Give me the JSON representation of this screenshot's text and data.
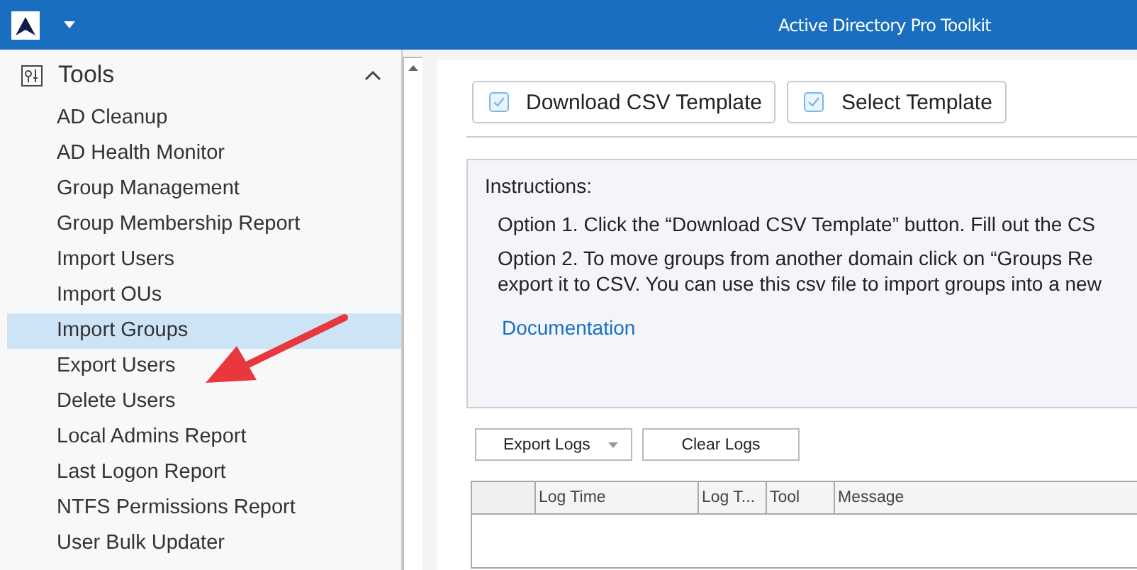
{
  "window": {
    "title": "Active Directory Pro Toolkit"
  },
  "sidebar": {
    "title": "Tools",
    "expanded": true,
    "items": [
      {
        "label": "AD Cleanup",
        "selected": false
      },
      {
        "label": "AD Health Monitor",
        "selected": false
      },
      {
        "label": "Group Management",
        "selected": false
      },
      {
        "label": "Group Membership Report",
        "selected": false
      },
      {
        "label": "Import Users",
        "selected": false
      },
      {
        "label": "Import OUs",
        "selected": false
      },
      {
        "label": "Import Groups",
        "selected": true
      },
      {
        "label": "Export Users",
        "selected": false
      },
      {
        "label": "Delete Users",
        "selected": false
      },
      {
        "label": "Local Admins Report",
        "selected": false
      },
      {
        "label": "Last Logon Report",
        "selected": false
      },
      {
        "label": "NTFS Permissions Report",
        "selected": false
      },
      {
        "label": "User Bulk Updater",
        "selected": false
      }
    ]
  },
  "toolbar": {
    "buttons": [
      "Download CSV Template",
      "Select Template"
    ]
  },
  "instructions": {
    "heading": "Instructions:",
    "options": [
      "Option 1. Click the “Download CSV Template” button. Fill out the CS",
      "Option 2. To move groups from another domain click on “Groups Re\nexport it to CSV. You can use this csv file to import groups into a new"
    ],
    "link": "Documentation"
  },
  "logs": {
    "buttons": [
      {
        "label": "Export Logs",
        "kind": "dropdown"
      },
      {
        "label": "Clear Logs",
        "kind": "plain"
      }
    ],
    "columns": [
      "Log Time",
      "Log T...",
      "Tool",
      "Message"
    ]
  }
}
